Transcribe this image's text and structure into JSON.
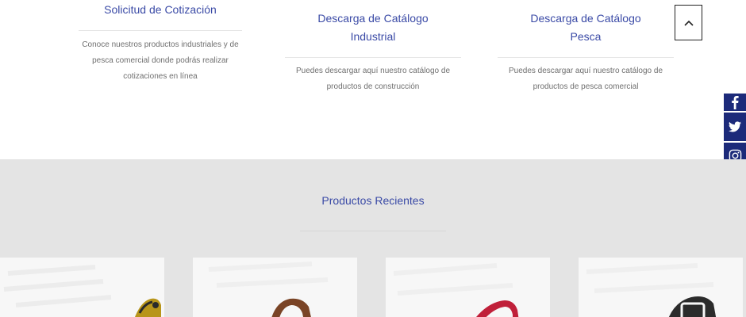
{
  "services": [
    {
      "title_line1": "Solicitud de Cotización",
      "title_line2": "",
      "description": "Conoce nuestros productos industriales y de pesca comercial donde podrás realizar cotizaciones en línea"
    },
    {
      "title_line1": "Descarga de Catálogo",
      "title_line2": "Industrial",
      "description": "Puedes descargar aquí nuestro catálogo de productos de construcción"
    },
    {
      "title_line1": "Descarga de Catálogo",
      "title_line2": "Pesca",
      "description": "Puedes descargar aquí nuestro catálogo de productos de pesca comercial"
    }
  ],
  "back_to_top": {
    "icon": "chevron-up-icon"
  },
  "social": [
    {
      "name": "facebook",
      "icon": "facebook-icon"
    },
    {
      "name": "twitter",
      "icon": "twitter-icon"
    },
    {
      "name": "instagram",
      "icon": "instagram-icon"
    }
  ],
  "recent_products": {
    "title": "Productos Recientes",
    "products": [
      {
        "image": "yellow-glove-image"
      },
      {
        "image": "brown-belt-image"
      },
      {
        "image": "red-harness-image"
      },
      {
        "image": "black-strap-image"
      }
    ]
  },
  "colors": {
    "accent": "#3a4aa6",
    "social_bg": "#1c2a7a",
    "section_bg": "#e4e4e4"
  }
}
